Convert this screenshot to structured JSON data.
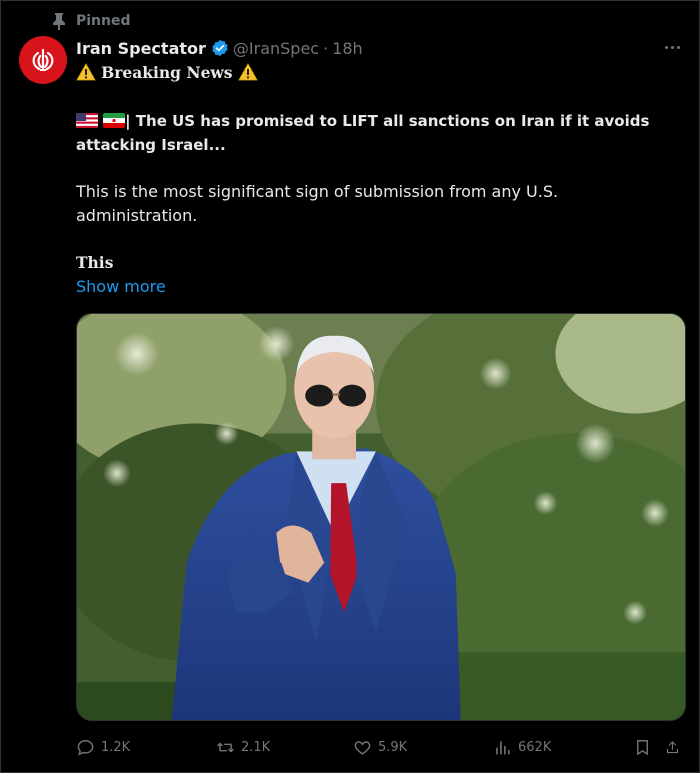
{
  "pinned_label": "Pinned",
  "author": {
    "name": "Iran Spectator",
    "handle": "@IranSpec",
    "separator": "·",
    "time": "18h"
  },
  "tweet": {
    "line1": "Breaking News",
    "line2a": "| The US has promised to LIFT all sanctions on Iran if it avoids",
    "line2b": "attacking Israel...",
    "line3a": "This is the most significant sign of submission from any U.S.",
    "line3b": "administration.",
    "line4": "This",
    "show_more": "Show more"
  },
  "metrics": {
    "replies": "1.2K",
    "reposts": "2.1K",
    "likes": "5.9K",
    "views": "662K"
  },
  "icons": {
    "pin": "pin-icon",
    "verified": "verified-badge-icon",
    "warning": "warning-icon",
    "us_flag": "us-flag-icon",
    "iran_flag": "iran-flag-icon",
    "more": "more-icon",
    "reply": "reply-icon",
    "repost": "repost-icon",
    "like": "like-icon",
    "views": "views-icon",
    "bookmark": "bookmark-icon",
    "share": "share-icon"
  },
  "colors": {
    "background": "#000000",
    "text": "#e7e9ea",
    "secondary": "#71767b",
    "link": "#1d9bf0",
    "avatar": "#d9131b"
  }
}
